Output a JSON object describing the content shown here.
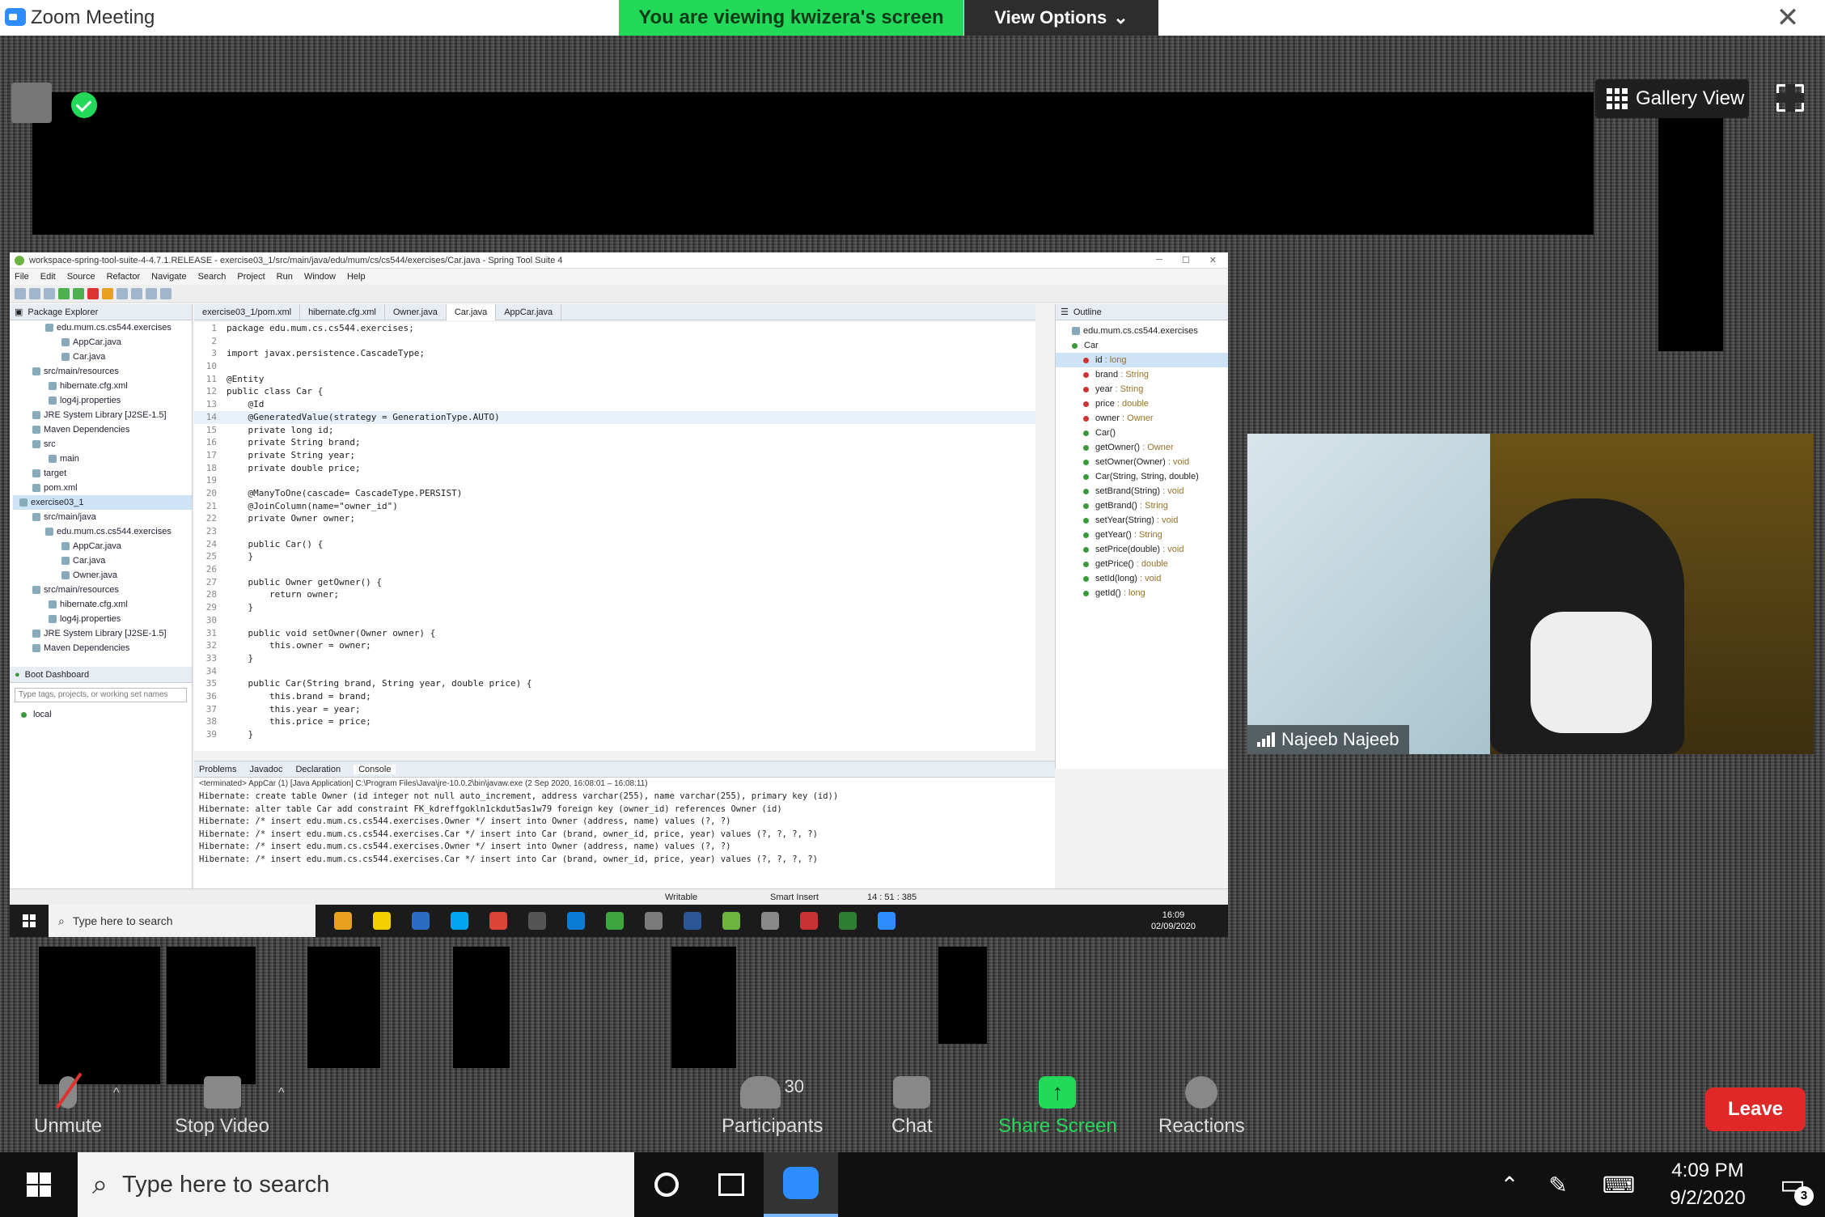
{
  "window": {
    "app_title": "Zoom Meeting",
    "viewing_banner": "You are viewing kwizera's screen",
    "view_options": "View Options",
    "close_symbol": "✕"
  },
  "meeting": {
    "gallery_view": "Gallery View",
    "participant_name": "Najeeb Najeeb"
  },
  "ide": {
    "title": "workspace-spring-tool-suite-4-4.7.1.RELEASE - exercise03_1/src/main/java/edu/mum/cs/cs544/exercises/Car.java - Spring Tool Suite 4",
    "menu": [
      "File",
      "Edit",
      "Source",
      "Refactor",
      "Navigate",
      "Search",
      "Project",
      "Run",
      "Window",
      "Help"
    ],
    "package_explorer": {
      "title": "Package Explorer",
      "items": [
        "edu.mum.cs.cs544.exercises",
        "AppCar.java",
        "Car.java",
        "src/main/resources",
        "hibernate.cfg.xml",
        "log4j.properties",
        "JRE System Library [J2SE-1.5]",
        "Maven Dependencies",
        "src",
        "main",
        "target",
        "pom.xml",
        "exercise03_1",
        "src/main/java",
        "edu.mum.cs.cs544.exercises",
        "AppCar.java",
        "Car.java",
        "Owner.java",
        "src/main/resources",
        "hibernate.cfg.xml",
        "log4j.properties",
        "JRE System Library [J2SE-1.5]",
        "Maven Dependencies",
        "src"
      ]
    },
    "boot_dashboard": {
      "title": "Boot Dashboard",
      "search_placeholder": "Type tags, projects, or working set names",
      "local": "local"
    },
    "editor_tabs": [
      "exercise03_1/pom.xml",
      "hibernate.cfg.xml",
      "Owner.java",
      "Car.java",
      "AppCar.java"
    ],
    "code_lines": [
      {
        "n": "1",
        "t": "package edu.mum.cs.cs544.exercises;"
      },
      {
        "n": "2",
        "t": ""
      },
      {
        "n": "3",
        "t": "import javax.persistence.CascadeType;"
      },
      {
        "n": "10",
        "t": ""
      },
      {
        "n": "11",
        "t": "@Entity"
      },
      {
        "n": "12",
        "t": "public class Car {"
      },
      {
        "n": "13",
        "t": "    @Id"
      },
      {
        "n": "14",
        "t": "    @GeneratedValue(strategy = GenerationType.AUTO)"
      },
      {
        "n": "15",
        "t": "    private long id;"
      },
      {
        "n": "16",
        "t": "    private String brand;"
      },
      {
        "n": "17",
        "t": "    private String year;"
      },
      {
        "n": "18",
        "t": "    private double price;"
      },
      {
        "n": "19",
        "t": ""
      },
      {
        "n": "20",
        "t": "    @ManyToOne(cascade= CascadeType.PERSIST)"
      },
      {
        "n": "21",
        "t": "    @JoinColumn(name=\"owner_id\")"
      },
      {
        "n": "22",
        "t": "    private Owner owner;"
      },
      {
        "n": "23",
        "t": ""
      },
      {
        "n": "24",
        "t": "    public Car() {"
      },
      {
        "n": "25",
        "t": "    }"
      },
      {
        "n": "26",
        "t": ""
      },
      {
        "n": "27",
        "t": "    public Owner getOwner() {"
      },
      {
        "n": "28",
        "t": "        return owner;"
      },
      {
        "n": "29",
        "t": "    }"
      },
      {
        "n": "30",
        "t": ""
      },
      {
        "n": "31",
        "t": "    public void setOwner(Owner owner) {"
      },
      {
        "n": "32",
        "t": "        this.owner = owner;"
      },
      {
        "n": "33",
        "t": "    }"
      },
      {
        "n": "34",
        "t": ""
      },
      {
        "n": "35",
        "t": "    public Car(String brand, String year, double price) {"
      },
      {
        "n": "36",
        "t": "        this.brand = brand;"
      },
      {
        "n": "37",
        "t": "        this.year = year;"
      },
      {
        "n": "38",
        "t": "        this.price = price;"
      },
      {
        "n": "39",
        "t": "    }"
      }
    ],
    "outline": {
      "title": "Outline",
      "package": "edu.mum.cs.cs544.exercises",
      "class": "Car",
      "members": [
        {
          "name": "id",
          "type": "long",
          "kind": "field"
        },
        {
          "name": "brand",
          "type": "String",
          "kind": "field"
        },
        {
          "name": "year",
          "type": "String",
          "kind": "field"
        },
        {
          "name": "price",
          "type": "double",
          "kind": "field"
        },
        {
          "name": "owner",
          "type": "Owner",
          "kind": "field"
        },
        {
          "name": "Car()",
          "type": "",
          "kind": "method"
        },
        {
          "name": "getOwner()",
          "type": "Owner",
          "kind": "method"
        },
        {
          "name": "setOwner(Owner)",
          "type": "void",
          "kind": "method"
        },
        {
          "name": "Car(String, String, double)",
          "type": "",
          "kind": "method"
        },
        {
          "name": "setBrand(String)",
          "type": "void",
          "kind": "method"
        },
        {
          "name": "getBrand()",
          "type": "String",
          "kind": "method"
        },
        {
          "name": "setYear(String)",
          "type": "void",
          "kind": "method"
        },
        {
          "name": "getYear()",
          "type": "String",
          "kind": "method"
        },
        {
          "name": "setPrice(double)",
          "type": "void",
          "kind": "method"
        },
        {
          "name": "getPrice()",
          "type": "double",
          "kind": "method"
        },
        {
          "name": "setId(long)",
          "type": "void",
          "kind": "method"
        },
        {
          "name": "getId()",
          "type": "long",
          "kind": "method"
        }
      ]
    },
    "console": {
      "tabs": [
        "Problems",
        "Javadoc",
        "Declaration",
        "Console"
      ],
      "header": "<terminated> AppCar (1) [Java Application] C:\\Program Files\\Java\\jre-10.0.2\\bin\\javaw.exe (2 Sep 2020, 16:08:01 – 16:08:11)",
      "lines": [
        "Hibernate: create table Owner (id integer not null auto_increment, address varchar(255), name varchar(255), primary key (id))",
        "Hibernate: alter table Car add constraint FK_kdreffgokln1ckdut5as1w79 foreign key (owner_id) references Owner (id)",
        "Hibernate: /* insert edu.mum.cs.cs544.exercises.Owner */ insert into Owner (address, name) values (?, ?)",
        "Hibernate: /* insert edu.mum.cs.cs544.exercises.Car */ insert into Car (brand, owner_id, price, year) values (?, ?, ?, ?)",
        "Hibernate: /* insert edu.mum.cs.cs544.exercises.Owner */ insert into Owner (address, name) values (?, ?)",
        "Hibernate: /* insert edu.mum.cs.cs544.exercises.Car */ insert into Car (brand, owner_id, price, year) values (?, ?, ?, ?)"
      ]
    },
    "status": {
      "writable": "Writable",
      "insert_mode": "Smart Insert",
      "position": "14 : 51 : 385"
    }
  },
  "remote_taskbar": {
    "search_placeholder": "Type here to search",
    "time": "16:09",
    "date": "02/09/2020",
    "app_colors": [
      "#e8a020",
      "#f4d000",
      "#2b6cc4",
      "#00a4ef",
      "#db4437",
      "#555555",
      "#0a7cd6",
      "#3ea63e",
      "#7a7a7a",
      "#2b5797",
      "#6db33f",
      "#888888",
      "#c83232",
      "#2e7d32",
      "#2d8cff"
    ]
  },
  "controls": {
    "unmute": "Unmute",
    "stop_video": "Stop Video",
    "participants": "Participants",
    "participant_count": "30",
    "chat": "Chat",
    "share_screen": "Share Screen",
    "reactions": "Reactions",
    "leave": "Leave",
    "colors": {
      "share": "#23d959",
      "leave": "#e02828"
    }
  },
  "host_taskbar": {
    "search_placeholder": "Type here to search",
    "time": "4:09 PM",
    "date": "9/2/2020",
    "notifications": "3"
  }
}
